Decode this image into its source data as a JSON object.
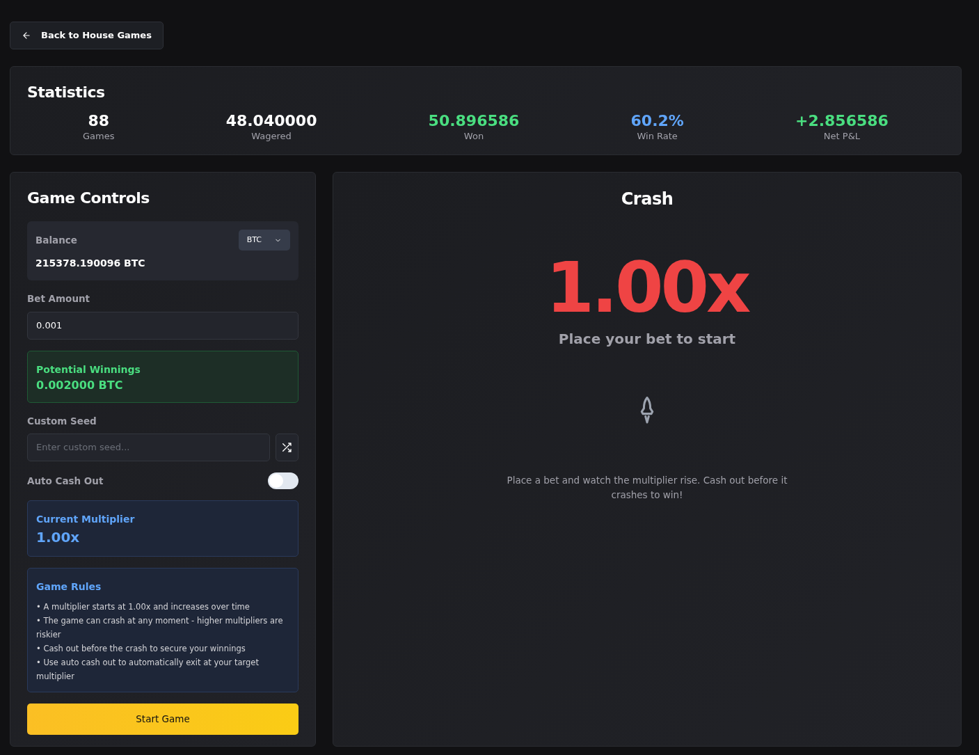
{
  "back_button": {
    "label": "Back to House Games"
  },
  "statistics": {
    "title": "Statistics",
    "items": [
      {
        "value": "88",
        "label": "Games",
        "color": "#ffffff"
      },
      {
        "value": "48.040000",
        "label": "Wagered",
        "color": "#ffffff"
      },
      {
        "value": "50.896586",
        "label": "Won",
        "color": "#4ade80"
      },
      {
        "value": "60.2%",
        "label": "Win Rate",
        "color": "#60a5fa"
      },
      {
        "value": "+2.856586",
        "label": "Net P&L",
        "color": "#4ade80"
      }
    ]
  },
  "controls": {
    "title": "Game Controls",
    "balance": {
      "label": "Balance",
      "value": "215378.190096 BTC",
      "currency": "BTC"
    },
    "bet_amount": {
      "label": "Bet Amount",
      "value": "0.001"
    },
    "potential_winnings": {
      "label": "Potential Winnings",
      "value": "0.002000 BTC"
    },
    "custom_seed": {
      "label": "Custom Seed",
      "placeholder": "Enter custom seed..."
    },
    "auto_cash_out": {
      "label": "Auto Cash Out",
      "on": false
    },
    "current_multiplier": {
      "label": "Current Multiplier",
      "value": "1.00x"
    },
    "rules": {
      "title": "Game Rules",
      "items": [
        "• A multiplier starts at 1.00x and increases over time",
        "• The game can crash at any moment - higher multipliers are riskier",
        "• Cash out before the crash to secure your winnings",
        "• Use auto cash out to automatically exit at your target multiplier"
      ]
    },
    "start_button": {
      "label": "Start Game"
    }
  },
  "game": {
    "title": "Crash",
    "multiplier": "1.00x",
    "status": "Place your bet to start",
    "description": "Place a bet and watch the multiplier rise. Cash out before it crashes to win!"
  }
}
